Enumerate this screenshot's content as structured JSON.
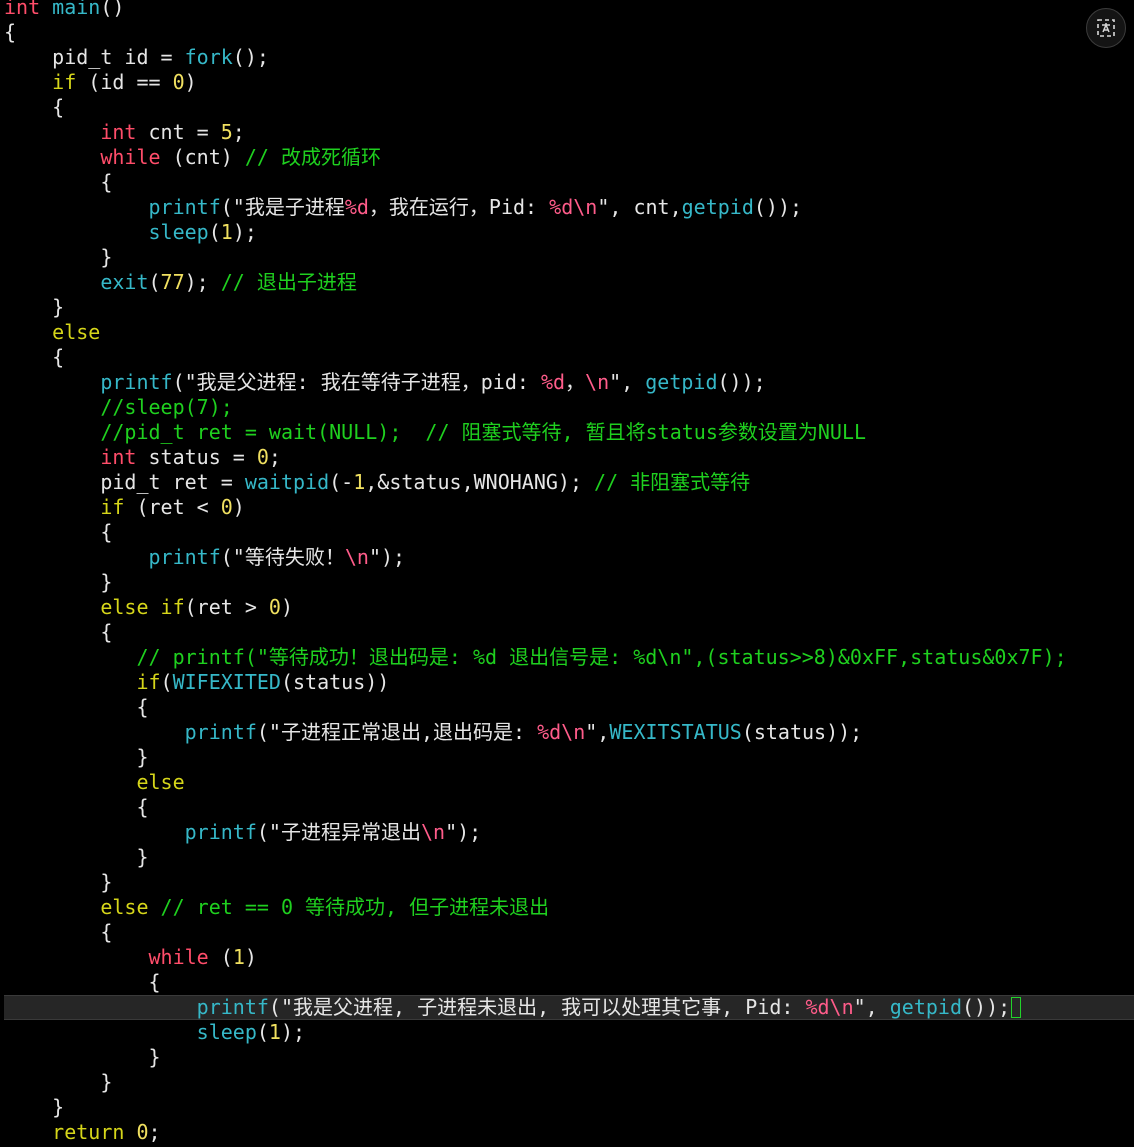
{
  "colors": {
    "background": "#000000",
    "default": "#e6e6e6",
    "type": "#ff4d6a",
    "function": "#36b8c8",
    "keyword": "#d6d61a",
    "string": "#e6e6e6",
    "escape": "#ff5c8a",
    "number": "#f0e060",
    "comment": "#1fd01f",
    "cursor": "#22d32a"
  },
  "cursor_line": 40,
  "translate_button": {
    "icon": "translate-icon"
  },
  "code_lines": [
    [
      [
        "type",
        "int"
      ],
      [
        "plain",
        " "
      ],
      [
        "func",
        "main"
      ],
      [
        "plain",
        "()"
      ]
    ],
    [
      [
        "plain",
        "{"
      ]
    ],
    [
      [
        "plain",
        "    pid_t id = "
      ],
      [
        "func",
        "fork"
      ],
      [
        "plain",
        "();"
      ]
    ],
    [
      [
        "plain",
        "    "
      ],
      [
        "kw",
        "if"
      ],
      [
        "plain",
        " (id == "
      ],
      [
        "num",
        "0"
      ],
      [
        "plain",
        ")"
      ]
    ],
    [
      [
        "plain",
        "    {"
      ]
    ],
    [
      [
        "plain",
        "        "
      ],
      [
        "type",
        "int"
      ],
      [
        "plain",
        " cnt = "
      ],
      [
        "num",
        "5"
      ],
      [
        "plain",
        ";"
      ]
    ],
    [
      [
        "plain",
        "        "
      ],
      [
        "type",
        "while"
      ],
      [
        "plain",
        " (cnt) "
      ],
      [
        "cmt",
        "// 改成死循环"
      ]
    ],
    [
      [
        "plain",
        "        {"
      ]
    ],
    [
      [
        "plain",
        "            "
      ],
      [
        "func",
        "printf"
      ],
      [
        "plain",
        "(\"我是子进程"
      ],
      [
        "esc",
        "%d"
      ],
      [
        "plain",
        "，我在运行，Pid: "
      ],
      [
        "esc",
        "%d\\n"
      ],
      [
        "plain",
        "\", cnt,"
      ],
      [
        "func",
        "getpid"
      ],
      [
        "plain",
        "());"
      ]
    ],
    [
      [
        "plain",
        "            "
      ],
      [
        "func",
        "sleep"
      ],
      [
        "plain",
        "("
      ],
      [
        "num",
        "1"
      ],
      [
        "plain",
        ");"
      ]
    ],
    [
      [
        "plain",
        "        }"
      ]
    ],
    [
      [
        "plain",
        "        "
      ],
      [
        "func",
        "exit"
      ],
      [
        "plain",
        "("
      ],
      [
        "num",
        "77"
      ],
      [
        "plain",
        "); "
      ],
      [
        "cmt",
        "// 退出子进程"
      ]
    ],
    [
      [
        "plain",
        "    }"
      ]
    ],
    [
      [
        "plain",
        "    "
      ],
      [
        "kw",
        "else"
      ]
    ],
    [
      [
        "plain",
        "    {"
      ]
    ],
    [
      [
        "plain",
        "        "
      ],
      [
        "func",
        "printf"
      ],
      [
        "plain",
        "(\"我是父进程: 我在等待子进程，pid: "
      ],
      [
        "esc",
        "%d"
      ],
      [
        "plain",
        "，"
      ],
      [
        "esc",
        "\\n"
      ],
      [
        "plain",
        "\", "
      ],
      [
        "func",
        "getpid"
      ],
      [
        "plain",
        "());"
      ]
    ],
    [
      [
        "plain",
        "        "
      ],
      [
        "cmt",
        "//sleep(7);"
      ]
    ],
    [
      [
        "plain",
        "        "
      ],
      [
        "cmt",
        "//pid_t ret = wait(NULL);  // 阻塞式等待, 暂且将status参数设置为NULL"
      ]
    ],
    [
      [
        "plain",
        "        "
      ],
      [
        "type",
        "int"
      ],
      [
        "plain",
        " status = "
      ],
      [
        "num",
        "0"
      ],
      [
        "plain",
        ";"
      ]
    ],
    [
      [
        "plain",
        "        pid_t ret = "
      ],
      [
        "func",
        "waitpid"
      ],
      [
        "plain",
        "(-"
      ],
      [
        "num",
        "1"
      ],
      [
        "plain",
        ",&status,WNOHANG); "
      ],
      [
        "cmt",
        "// 非阻塞式等待"
      ]
    ],
    [
      [
        "plain",
        "        "
      ],
      [
        "kw",
        "if"
      ],
      [
        "plain",
        " (ret < "
      ],
      [
        "num",
        "0"
      ],
      [
        "plain",
        ")"
      ]
    ],
    [
      [
        "plain",
        "        {"
      ]
    ],
    [
      [
        "plain",
        "            "
      ],
      [
        "func",
        "printf"
      ],
      [
        "plain",
        "(\"等待失败！"
      ],
      [
        "esc",
        "\\n"
      ],
      [
        "plain",
        "\");"
      ]
    ],
    [
      [
        "plain",
        "        }"
      ]
    ],
    [
      [
        "plain",
        "        "
      ],
      [
        "kw",
        "else if"
      ],
      [
        "plain",
        "(ret > "
      ],
      [
        "num",
        "0"
      ],
      [
        "plain",
        ")"
      ]
    ],
    [
      [
        "plain",
        "        {"
      ]
    ],
    [
      [
        "plain",
        "           "
      ],
      [
        "cmt",
        "// printf(\"等待成功！退出码是: %d 退出信号是: %d\\n\",(status>>8)&0xFF,status&0x7F);"
      ]
    ],
    [
      [
        "plain",
        "           "
      ],
      [
        "kw",
        "if"
      ],
      [
        "plain",
        "("
      ],
      [
        "func",
        "WIFEXITED"
      ],
      [
        "plain",
        "(status))"
      ]
    ],
    [
      [
        "plain",
        "           {"
      ]
    ],
    [
      [
        "plain",
        "               "
      ],
      [
        "func",
        "printf"
      ],
      [
        "plain",
        "(\"子进程正常退出,退出码是: "
      ],
      [
        "esc",
        "%d\\n"
      ],
      [
        "plain",
        "\","
      ],
      [
        "func",
        "WEXITSTATUS"
      ],
      [
        "plain",
        "(status));"
      ]
    ],
    [
      [
        "plain",
        "           }"
      ]
    ],
    [
      [
        "plain",
        "           "
      ],
      [
        "kw",
        "else"
      ]
    ],
    [
      [
        "plain",
        "           {"
      ]
    ],
    [
      [
        "plain",
        "               "
      ],
      [
        "func",
        "printf"
      ],
      [
        "plain",
        "(\"子进程异常退出"
      ],
      [
        "esc",
        "\\n"
      ],
      [
        "plain",
        "\");"
      ]
    ],
    [
      [
        "plain",
        "           }"
      ]
    ],
    [
      [
        "plain",
        "        }"
      ]
    ],
    [
      [
        "plain",
        "        "
      ],
      [
        "kw",
        "else"
      ],
      [
        "plain",
        " "
      ],
      [
        "cmt",
        "// ret == 0 等待成功, 但子进程未退出"
      ]
    ],
    [
      [
        "plain",
        "        {"
      ]
    ],
    [
      [
        "plain",
        "            "
      ],
      [
        "type",
        "while"
      ],
      [
        "plain",
        " ("
      ],
      [
        "num",
        "1"
      ],
      [
        "plain",
        ")"
      ]
    ],
    [
      [
        "plain",
        "            {"
      ]
    ],
    [
      [
        "plain",
        "                "
      ],
      [
        "func",
        "printf"
      ],
      [
        "plain",
        "(\"我是父进程, 子进程未退出, 我可以处理其它事, Pid: "
      ],
      [
        "esc",
        "%d\\n"
      ],
      [
        "plain",
        "\", "
      ],
      [
        "func",
        "getpid"
      ],
      [
        "plain",
        "());"
      ]
    ],
    [
      [
        "plain",
        "                "
      ],
      [
        "func",
        "sleep"
      ],
      [
        "plain",
        "("
      ],
      [
        "num",
        "1"
      ],
      [
        "plain",
        ");"
      ]
    ],
    [
      [
        "plain",
        "            }"
      ]
    ],
    [
      [
        "plain",
        "        }"
      ]
    ],
    [
      [
        "plain",
        "    }"
      ]
    ],
    [
      [
        "plain",
        "    "
      ],
      [
        "kw",
        "return"
      ],
      [
        "plain",
        " "
      ],
      [
        "num",
        "0"
      ],
      [
        "plain",
        ";"
      ]
    ]
  ]
}
